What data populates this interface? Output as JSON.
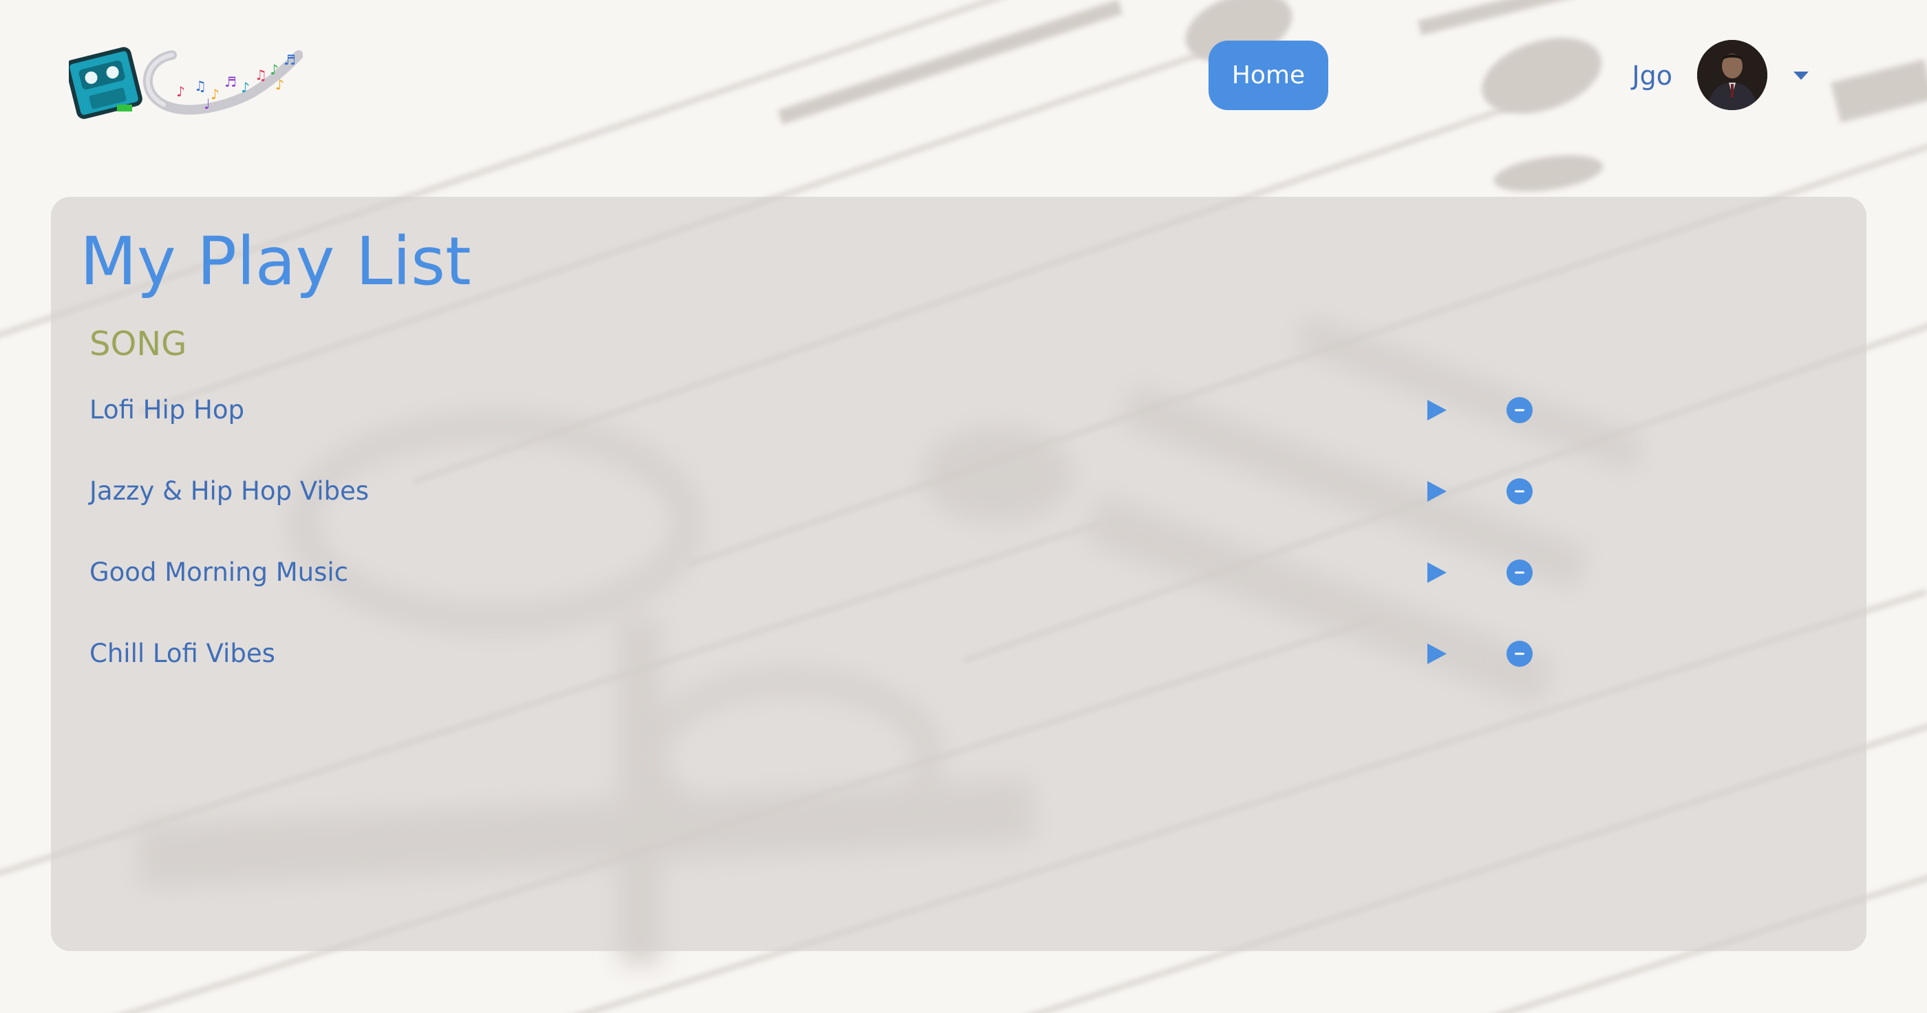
{
  "header": {
    "logo_name": "music-logo",
    "nav": {
      "home_label": "Home"
    },
    "user": {
      "name": "Jgo"
    }
  },
  "playlist": {
    "title": "My Play List",
    "column_header": "SONG",
    "songs": [
      {
        "title": "Lofi Hip Hop"
      },
      {
        "title": "Jazzy & Hip Hop Vibes"
      },
      {
        "title": "Good Morning Music"
      },
      {
        "title": "Chill Lofi Vibes"
      }
    ]
  },
  "icons": {
    "play": "play-icon",
    "remove": "remove-icon",
    "dropdown": "caret-down-icon"
  },
  "colors": {
    "accent": "#4a8fe2",
    "link": "#3f6eb8",
    "header_label": "#9ca55a"
  }
}
